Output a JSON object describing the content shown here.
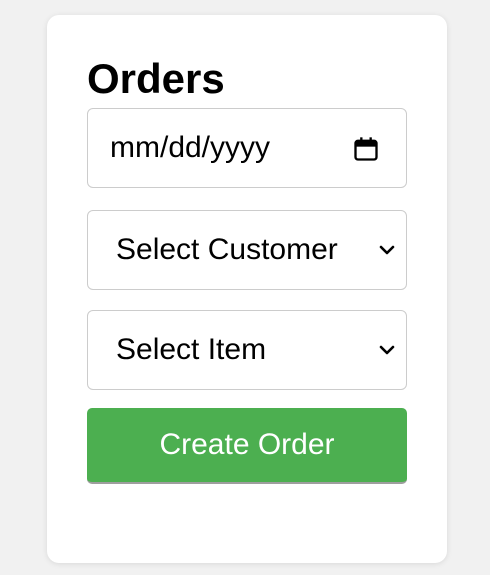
{
  "page": {
    "title": "Orders"
  },
  "form": {
    "date_placeholder": "mm/dd/yyyy",
    "customer_select": {
      "selected": "Select Customer"
    },
    "item_select": {
      "selected": "Select Item"
    },
    "submit_label": "Create Order"
  },
  "icons": {
    "date": "calendar-icon",
    "dropdown": "chevron-down-icon"
  },
  "colors": {
    "background": "#f1f1f1",
    "card": "#ffffff",
    "button": "#4caf50",
    "button_text": "#ffffff",
    "border": "#cccccc"
  }
}
